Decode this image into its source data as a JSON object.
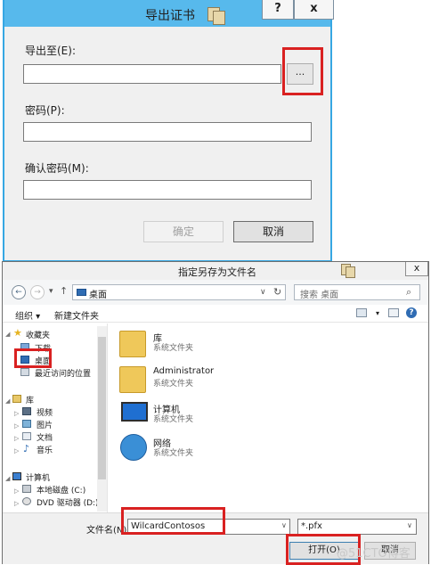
{
  "export_dialog": {
    "title": "导出证书",
    "help_button": "?",
    "close_button": "x",
    "export_to_label": "导出至(E):",
    "export_to_value": "",
    "browse_button": "...",
    "password_label": "密码(P):",
    "password_value": "",
    "confirm_password_label": "确认密码(M):",
    "confirm_password_value": "",
    "ok_button": "确定",
    "cancel_button": "取消"
  },
  "save_dialog": {
    "title": "指定另存为文件名",
    "close_button": "x",
    "address": "桌面",
    "search_placeholder": "搜索 桌面",
    "toolbar": {
      "organize": "组织 ▾",
      "new_folder": "新建文件夹"
    },
    "sidebar": {
      "favorites": "收藏夹",
      "downloads": "下载",
      "desktop": "桌面",
      "recent": "最近访问的位置",
      "libraries": "库",
      "videos": "视频",
      "pictures": "图片",
      "documents": "文档",
      "music": "音乐",
      "computer": "计算机",
      "local_disk": "本地磁盘 (C:)",
      "dvd_drive": "DVD 驱动器 (D:)"
    },
    "items": [
      {
        "name": "库",
        "type": "系统文件夹",
        "icon": "library-icon"
      },
      {
        "name": "Administrator",
        "type": "系统文件夹",
        "icon": "user-folder-icon"
      },
      {
        "name": "计算机",
        "type": "系统文件夹",
        "icon": "computer-icon"
      },
      {
        "name": "网络",
        "type": "系统文件夹",
        "icon": "network-icon"
      }
    ],
    "filename_label": "文件名(N):",
    "filename_value": "WilcardContosos",
    "filetype_value": "*.pfx",
    "open_button": "打开(O)",
    "cancel_button": "取消"
  },
  "watermark": "@51CTO博客",
  "colors": {
    "title_blue": "#57b9ec",
    "highlight_red": "#d92121"
  }
}
